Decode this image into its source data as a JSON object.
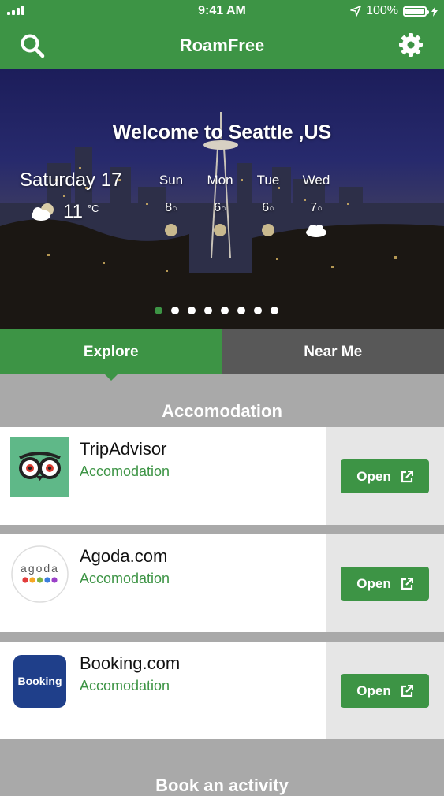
{
  "status": {
    "time": "9:41 AM",
    "battery": "100%"
  },
  "app": {
    "title": "RoamFree"
  },
  "hero": {
    "welcome": "Welcome to Seattle ,US",
    "today": {
      "day": "Saturday 17",
      "temp": "11",
      "unit": "°C",
      "icon": "partly-cloudy-night-icon"
    },
    "forecast": [
      {
        "day": "Sun",
        "temp": "8",
        "unit": "○",
        "icon": "moon-icon"
      },
      {
        "day": "Mon",
        "temp": "6",
        "unit": "○",
        "icon": "moon-icon"
      },
      {
        "day": "Tue",
        "temp": "6",
        "unit": "○",
        "icon": "moon-icon"
      },
      {
        "day": "Wed",
        "temp": "7",
        "unit": "○",
        "icon": "cloud-icon"
      }
    ],
    "carousel": {
      "count": 8,
      "active_index": 0
    }
  },
  "tabs": [
    {
      "label": "Explore",
      "active": true
    },
    {
      "label": "Near Me",
      "active": false
    }
  ],
  "section": {
    "title": "Accomodation",
    "items": [
      {
        "name": "TripAdvisor",
        "category": "Accomodation",
        "button": "Open",
        "logo": "tripadvisor-logo"
      },
      {
        "name": "Agoda.com",
        "category": "Accomodation",
        "button": "Open",
        "logo": "agoda-logo",
        "logo_text": "agoda"
      },
      {
        "name": "Booking.com",
        "category": "Accomodation",
        "button": "Open",
        "logo": "booking-logo",
        "logo_text": "Booking"
      }
    ]
  },
  "next_section": {
    "title": "Book an activity"
  },
  "colors": {
    "brand_green": "#3d9445",
    "tab_inactive": "#585858",
    "background": "#a9a9a9"
  }
}
